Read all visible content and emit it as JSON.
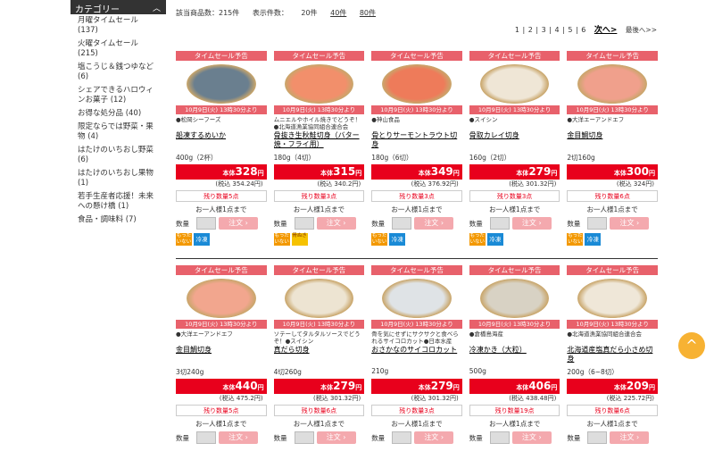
{
  "sidebar": {
    "title": "カテゴリー",
    "items": [
      "月曜タイムセール (137)",
      "火曜タイムセール (215)",
      "塩こうじ＆銭つゆなど (6)",
      "シェアできるハロウィンお菓子 (12)",
      "お得な処分品 (40)",
      "限定ならでは野菜・果物 (4)",
      "はたけのいちおし野菜 (6)",
      "はたけのいちおし果物 (1)",
      "若手生産者応援！未来への懸け橋 (1)",
      "食品・調味料 (7)"
    ]
  },
  "topbar": {
    "count_label": "該当商品数：215件",
    "display_label": "表示件数：",
    "opt1": "20件",
    "opt2": "40件",
    "opt3": "80件"
  },
  "pager": {
    "pages": [
      "1",
      "2",
      "3",
      "4",
      "5",
      "6"
    ],
    "next": "次へ>",
    "last": "最後へ>>"
  },
  "common": {
    "sale_tag": "タイムセール予告",
    "date_tag": "10月9日(火) 13時30分より",
    "price_label": "本体",
    "yen": "円",
    "limit": "お一人様1点まで",
    "qty_label": "数量",
    "order_btn": "注文 ›",
    "badge_mot": "もったいない",
    "badge_rei": "冷凍",
    "badge_hon": "骨ぬき"
  },
  "products": [
    {
      "maker": "●松岡シーフーズ",
      "name": "船凍するめいか",
      "spec": "400g（2杯）",
      "price": "328",
      "taxed": "(税込 354.24円)",
      "stock": "残り数量5点",
      "photo": "#6a7f8f",
      "badges": [
        "mot",
        "rei"
      ]
    },
    {
      "maker": "ムニエルやホイル焼きでどうぞ！●北海道漁業協同組合連合会",
      "name": "骨抜き生秋鮭切身（バター焼・フライ用）",
      "spec": "180g（4切）",
      "price": "315",
      "taxed": "(税込 340.2円)",
      "stock": "残り数量3点",
      "photo": "#f28f6b",
      "badges": [
        "mot",
        "hon"
      ]
    },
    {
      "maker": "●神山食品",
      "name": "骨とりサーモントラウト切身",
      "spec": "180g（6切）",
      "price": "349",
      "taxed": "(税込 376.92円)",
      "stock": "残り数量3点",
      "photo": "#ee7b5a",
      "badges": [
        "mot",
        "rei"
      ]
    },
    {
      "maker": "●スイシン",
      "name": "骨取カレイ切身",
      "spec": "160g（2切）",
      "price": "279",
      "taxed": "(税込 301.32円)",
      "stock": "残り数量3点",
      "photo": "#efe6d6",
      "badges": [
        "mot",
        "rei"
      ]
    },
    {
      "maker": "●大洋エーアンドエフ",
      "name": "金目鯛切身",
      "spec": "2切160g",
      "price": "300",
      "taxed": "(税込 324円)",
      "stock": "残り数量6点",
      "photo": "#f0a08c",
      "badges": [
        "mot",
        "rei"
      ]
    },
    {
      "maker": "●大洋エーアンドエフ",
      "name": "金目鯛切身",
      "spec": "3切240g",
      "price": "440",
      "taxed": "(税込 475.2円)",
      "stock": "残り数量5点",
      "photo": "#f2a68e",
      "badges": []
    },
    {
      "maker": "ソテーしてタルタルソースでどうぞ！●スイシン",
      "name": "真だら切身",
      "spec": "4切260g",
      "price": "279",
      "taxed": "(税込 301.32円)",
      "stock": "残り数量6点",
      "photo": "#ede4d2",
      "badges": []
    },
    {
      "maker": "骨を気にせずにサクサクと食べられるサイコロカット●日本水産",
      "name": "おさかなのサイコロカット",
      "spec": "210g",
      "price": "279",
      "taxed": "(税込 301.32円)",
      "stock": "残り数量3点",
      "photo": "#dfe3e6",
      "badges": []
    },
    {
      "maker": "●倉橋島海産",
      "name": "冷凍かき（大粒）",
      "spec": "500g",
      "price": "406",
      "taxed": "(税込 438.48円)",
      "stock": "残り数量19点",
      "photo": "#d8d2c4",
      "badges": []
    },
    {
      "maker": "●北海道漁業協同組合連合会",
      "name": "北海道産塩真だら小さめ切身",
      "spec": "200g（6~8切）",
      "price": "209",
      "taxed": "(税込 225.72円)",
      "stock": "残り数量6点",
      "photo": "#efe7d8",
      "badges": []
    }
  ],
  "scroll_top": "^"
}
